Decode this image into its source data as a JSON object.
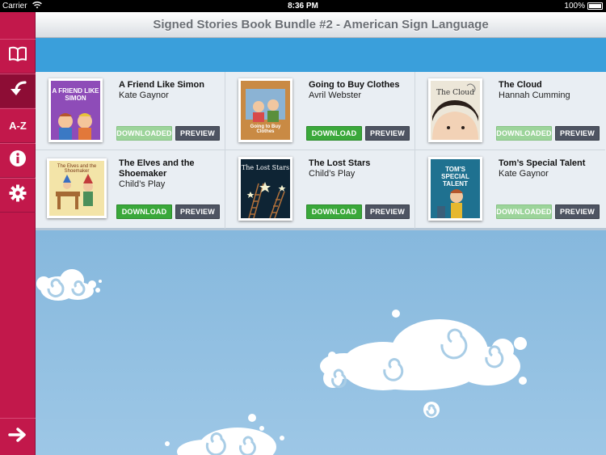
{
  "status": {
    "carrier": "Carrier",
    "time": "8:36 PM",
    "battery": "100%"
  },
  "nav": {
    "title": "Signed Stories Book Bundle #2 - American Sign Language",
    "sidebar": {
      "az_label": "A-Z"
    }
  },
  "books": [
    {
      "title": "A Friend Like Simon",
      "author": "Kate Gaynor",
      "download": "DOWNLOADED",
      "downloaded": true,
      "preview": "PREVIEW",
      "cover_text": "A FRIEND LIKE SIMON",
      "cover_color": "#7a3fa0"
    },
    {
      "title": "Going to Buy Clothes",
      "author": "Avril Webster",
      "download": "DOWNLOAD",
      "downloaded": false,
      "preview": "PREVIEW",
      "cover_text": "Going to Buy Clothes",
      "cover_color": "#c9843d"
    },
    {
      "title": "The Cloud",
      "author": "Hannah Cumming",
      "download": "DOWNLOADED",
      "downloaded": true,
      "preview": "PREVIEW",
      "cover_text": "The Cloud",
      "cover_color": "#e8e1d2"
    },
    {
      "title": "The Elves and the Shoemaker",
      "author": "Child’s Play",
      "download": "DOWNLOAD",
      "downloaded": false,
      "preview": "PREVIEW",
      "cover_text": "The Elves and the Shoemaker",
      "cover_color": "#f2e3a6"
    },
    {
      "title": "The Lost Stars",
      "author": "Child’s Play",
      "download": "DOWNLOAD",
      "downloaded": false,
      "preview": "PREVIEW",
      "cover_text": "The Lost Stars",
      "cover_color": "#0d2233"
    },
    {
      "title": "Tom’s Special Talent",
      "author": "Kate Gaynor",
      "download": "DOWNLOADED",
      "downloaded": true,
      "preview": "PREVIEW",
      "cover_text": "TOM'S SPECIAL TALENT",
      "cover_color": "#1e6f8c"
    }
  ]
}
